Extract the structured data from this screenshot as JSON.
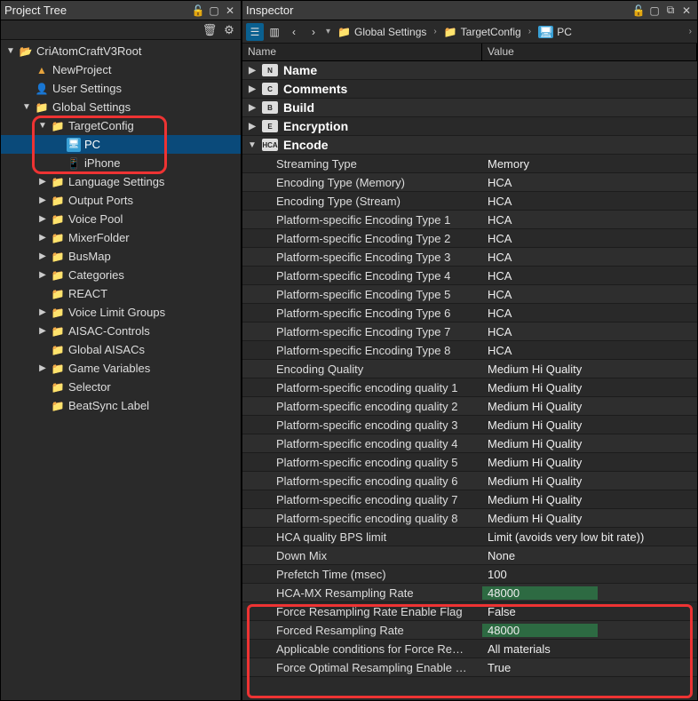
{
  "project_tree": {
    "title": "Project Tree",
    "nodes": [
      {
        "depth": 0,
        "arrow": "down",
        "icon": "folder-yel",
        "label": "CriAtomCraftV3Root"
      },
      {
        "depth": 1,
        "arrow": "none",
        "icon": "tri-orange",
        "label": "NewProject"
      },
      {
        "depth": 1,
        "arrow": "none",
        "icon": "user-blue",
        "label": "User Settings"
      },
      {
        "depth": 1,
        "arrow": "down",
        "icon": "folder-red",
        "label": "Global Settings"
      },
      {
        "depth": 2,
        "arrow": "down",
        "icon": "folder-red",
        "label": "TargetConfig"
      },
      {
        "depth": 3,
        "arrow": "none",
        "icon": "monitor",
        "label": "PC",
        "selected": true
      },
      {
        "depth": 3,
        "arrow": "none",
        "icon": "phone",
        "label": "iPhone"
      },
      {
        "depth": 2,
        "arrow": "right",
        "icon": "folder-red",
        "label": "Language Settings"
      },
      {
        "depth": 2,
        "arrow": "right",
        "icon": "folder-red",
        "label": "Output Ports"
      },
      {
        "depth": 2,
        "arrow": "right",
        "icon": "folder-red",
        "label": "Voice Pool"
      },
      {
        "depth": 2,
        "arrow": "right",
        "icon": "folder-red",
        "label": "MixerFolder"
      },
      {
        "depth": 2,
        "arrow": "right",
        "icon": "folder-red",
        "label": "BusMap"
      },
      {
        "depth": 2,
        "arrow": "right",
        "icon": "folder-red",
        "label": "Categories"
      },
      {
        "depth": 2,
        "arrow": "none",
        "icon": "folder-red",
        "label": "REACT"
      },
      {
        "depth": 2,
        "arrow": "right",
        "icon": "folder-red",
        "label": "Voice Limit Groups"
      },
      {
        "depth": 2,
        "arrow": "right",
        "icon": "folder-red",
        "label": "AISAC-Controls"
      },
      {
        "depth": 2,
        "arrow": "none",
        "icon": "folder-red",
        "label": "Global AISACs"
      },
      {
        "depth": 2,
        "arrow": "right",
        "icon": "folder-red",
        "label": "Game Variables"
      },
      {
        "depth": 2,
        "arrow": "none",
        "icon": "folder-red",
        "label": "Selector"
      },
      {
        "depth": 2,
        "arrow": "none",
        "icon": "folder-red",
        "label": "BeatSync Label"
      }
    ]
  },
  "inspector": {
    "title": "Inspector",
    "breadcrumb": {
      "items": [
        "Global Settings",
        "TargetConfig",
        "PC"
      ]
    },
    "columns": {
      "name": "Name",
      "value": "Value"
    },
    "sections": [
      {
        "type": "section",
        "arrow": "right",
        "icon": "N",
        "label": "Name"
      },
      {
        "type": "section",
        "arrow": "right",
        "icon": "C",
        "label": "Comments"
      },
      {
        "type": "section",
        "arrow": "right",
        "icon": "B",
        "label": "Build"
      },
      {
        "type": "section",
        "arrow": "right",
        "icon": "E",
        "label": "Encryption"
      },
      {
        "type": "section",
        "arrow": "down",
        "icon": "HCA",
        "label": "Encode"
      }
    ],
    "encode_props": [
      {
        "name": "Streaming Type",
        "value": "Memory"
      },
      {
        "name": "Encoding Type (Memory)",
        "value": "HCA"
      },
      {
        "name": "Encoding Type (Stream)",
        "value": "HCA"
      },
      {
        "name": "Platform-specific Encoding Type 1",
        "value": "HCA"
      },
      {
        "name": "Platform-specific Encoding Type 2",
        "value": "HCA"
      },
      {
        "name": "Platform-specific Encoding Type 3",
        "value": "HCA"
      },
      {
        "name": "Platform-specific Encoding Type 4",
        "value": "HCA"
      },
      {
        "name": "Platform-specific Encoding Type 5",
        "value": "HCA"
      },
      {
        "name": "Platform-specific Encoding Type 6",
        "value": "HCA"
      },
      {
        "name": "Platform-specific Encoding Type 7",
        "value": "HCA"
      },
      {
        "name": "Platform-specific Encoding Type 8",
        "value": "HCA"
      },
      {
        "name": "Encoding Quality",
        "value": "Medium Hi Quality"
      },
      {
        "name": "Platform-specific encoding quality 1",
        "value": "Medium Hi Quality"
      },
      {
        "name": "Platform-specific encoding quality 2",
        "value": "Medium Hi Quality"
      },
      {
        "name": "Platform-specific encoding quality 3",
        "value": "Medium Hi Quality"
      },
      {
        "name": "Platform-specific encoding quality 4",
        "value": "Medium Hi Quality"
      },
      {
        "name": "Platform-specific encoding quality 5",
        "value": "Medium Hi Quality"
      },
      {
        "name": "Platform-specific encoding quality 6",
        "value": "Medium Hi Quality"
      },
      {
        "name": "Platform-specific encoding quality 7",
        "value": "Medium Hi Quality"
      },
      {
        "name": "Platform-specific encoding quality 8",
        "value": "Medium Hi Quality"
      },
      {
        "name": "HCA quality BPS limit",
        "value": "Limit (avoids very low bit rate))"
      },
      {
        "name": "Down Mix",
        "value": "None"
      },
      {
        "name": "Prefetch Time (msec)",
        "value": "100"
      },
      {
        "name": "HCA-MX Resampling Rate",
        "value": "48000",
        "green": true
      },
      {
        "name": "Force Resampling Rate Enable Flag",
        "value": "False"
      },
      {
        "name": "Forced Resampling Rate",
        "value": "48000",
        "green": true
      },
      {
        "name": "Applicable conditions for Force Re…",
        "value": "All materials"
      },
      {
        "name": "Force Optimal Resampling Enable …",
        "value": "True"
      }
    ]
  }
}
